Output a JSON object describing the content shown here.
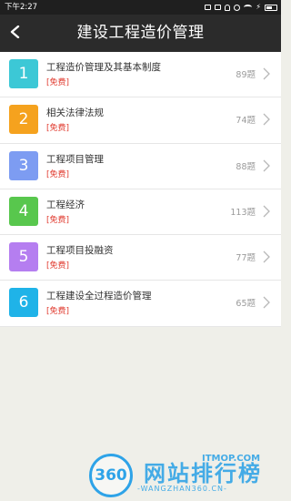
{
  "status_bar": {
    "time": "下午2:27"
  },
  "header": {
    "title": "建设工程造价管理"
  },
  "items": [
    {
      "num": "1",
      "title": "工程造价管理及其基本制度",
      "tag": "[免费]",
      "count": "89题",
      "color": "#3cc8d6"
    },
    {
      "num": "2",
      "title": "相关法律法规",
      "tag": "[免费]",
      "count": "74题",
      "color": "#f5a21e"
    },
    {
      "num": "3",
      "title": "工程项目管理",
      "tag": "[免费]",
      "count": "88题",
      "color": "#7d9cf2"
    },
    {
      "num": "4",
      "title": "工程经济",
      "tag": "[免费]",
      "count": "113题",
      "color": "#58c74d"
    },
    {
      "num": "5",
      "title": "工程项目投融资",
      "tag": "[免费]",
      "count": "77题",
      "color": "#b57ef0"
    },
    {
      "num": "6",
      "title": "工程建设全过程造价管理",
      "tag": "[免费]",
      "count": "65题",
      "color": "#1fb3e8"
    }
  ],
  "watermark": {
    "logo_text": "360",
    "name": "网站排行榜",
    "brand": "ITMOP.COM",
    "url": "-WANGZHAN360.CN-"
  }
}
